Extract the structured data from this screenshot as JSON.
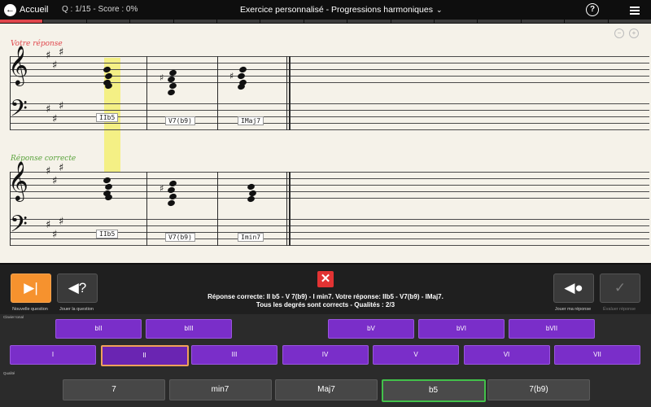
{
  "topbar": {
    "back_label": "Accueil",
    "score_text": "Q : 1/15 - Score : 0%",
    "title": "Exercice personnalisé - Progressions harmoniques",
    "help_symbol": "?",
    "progress_fraction": 0.0667
  },
  "score": {
    "your_answer_label": "Votre réponse",
    "correct_answer_label": "Réponse correcte",
    "your_chords": [
      "IIb5",
      "V7(b9)",
      "IMaj7"
    ],
    "correct_chords": [
      "IIb5",
      "V7(b9)",
      "Imin7"
    ],
    "your_answer_color": "#e0474c",
    "correct_answer_color": "#5aa33c",
    "highlight_color": "#f4ef7a"
  },
  "controls": {
    "next_caption": "Nouvelle question",
    "play_question_caption": "Jouer la question",
    "play_answer_caption": "Jouer ma réponse",
    "evaluate_caption": "Évaluer réponse",
    "result_line1": "Réponse correcte: II b5 - V 7(b9) - I min7. Votre réponse: IIb5 - V7(b9) - IMaj7.",
    "result_line2": "Tous les degrés sont corrects - Qualités : 2/3"
  },
  "keyboard": {
    "tonal_label": "Clavier tonal",
    "quality_label": "Qualité",
    "altered_degrees": [
      "bII",
      "bIII",
      "bV",
      "bVI",
      "bVII"
    ],
    "degrees": [
      "I",
      "II",
      "III",
      "IV",
      "V",
      "VI",
      "VII"
    ],
    "selected_degree": "II",
    "qualities": [
      "7",
      "min7",
      "Maj7",
      "b5",
      "7(b9)"
    ],
    "selected_quality": "b5"
  }
}
